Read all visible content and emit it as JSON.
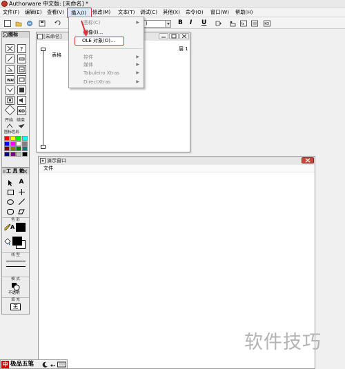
{
  "window": {
    "title": "Authorware 中文版: [未命名] *"
  },
  "menubar": {
    "items": [
      "文件(F)",
      "编辑(E)",
      "查看(V)",
      "插入(I)",
      "修改(M)",
      "文本(T)",
      "调试(C)",
      "其他(X)",
      "命令(O)",
      "窗口(W)",
      "帮助(H)"
    ]
  },
  "toolbar": {
    "font_value": ")",
    "bold": "B",
    "italic": "I",
    "underline": "U"
  },
  "insert_menu": {
    "items": [
      {
        "label": "图标(C)",
        "submenu": true,
        "disabled": true
      },
      {
        "label": "图像(I)...",
        "submenu": false,
        "disabled": false
      },
      {
        "label": "OLE 对象(O)...",
        "submenu": false,
        "disabled": false,
        "highlighted": true
      },
      {
        "label": "控件",
        "submenu": true,
        "disabled": true
      },
      {
        "label": "媒体",
        "submenu": true,
        "disabled": true
      },
      {
        "label": "Tabuleiro Xtras",
        "submenu": true,
        "disabled": true
      },
      {
        "label": "DirectXtras",
        "submenu": true,
        "disabled": true
      }
    ]
  },
  "icon_palette": {
    "title": "图标",
    "start_label": "开始",
    "end_label": "结束",
    "color_label": "图标色彩",
    "swatch_colors": [
      "#ff0000",
      "#ffff00",
      "#00ff00",
      "#00ffff",
      "#0000ff",
      "#ff00ff",
      "#ffffff",
      "#808080",
      "#800000",
      "#808000",
      "#008000",
      "#008080",
      "#000080",
      "#800080",
      "#c0c0c0",
      "#000000"
    ]
  },
  "tools_palette": {
    "title": "工 具 箱",
    "color_section": "色 彩",
    "line_section": "线 型",
    "mode_section": "模 式",
    "mode_value": "不透明",
    "fill_section": "填 充",
    "fill_value": "无"
  },
  "flow_window": {
    "title": "[未命名]",
    "level_label": "层 1",
    "icon_label": "表格"
  },
  "presentation_window": {
    "title": "演示窗口",
    "menu_file": "文件"
  },
  "ime": {
    "label": "极品五笔"
  },
  "watermark": "软件技巧"
}
